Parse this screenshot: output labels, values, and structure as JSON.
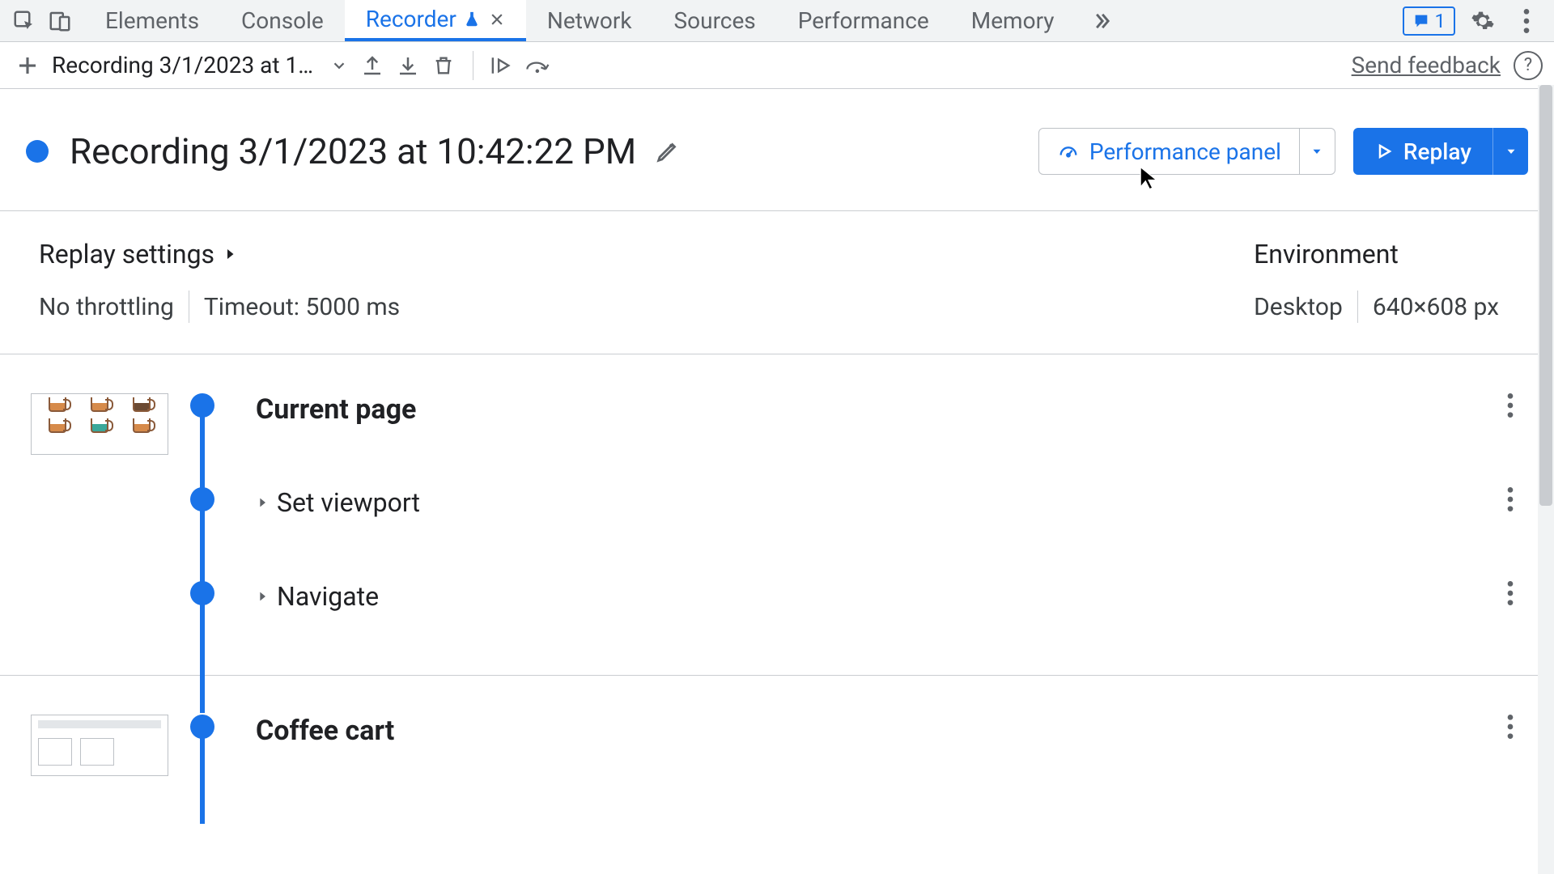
{
  "tabs": {
    "elements": "Elements",
    "console": "Console",
    "recorder": "Recorder",
    "network": "Network",
    "sources": "Sources",
    "performance": "Performance",
    "memory": "Memory"
  },
  "issues_count": "1",
  "toolbar": {
    "recording_select": "Recording 3/1/2023 at 10…",
    "feedback": "Send feedback"
  },
  "title": "Recording 3/1/2023 at 10:42:22 PM",
  "perf_panel": "Performance panel",
  "replay": "Replay",
  "settings": {
    "header": "Replay settings",
    "throttling": "No throttling",
    "timeout": "Timeout: 5000 ms"
  },
  "environment": {
    "header": "Environment",
    "device": "Desktop",
    "viewport": "640×608 px"
  },
  "steps": {
    "current_page": "Current page",
    "set_viewport": "Set viewport",
    "navigate": "Navigate",
    "coffee_cart": "Coffee cart"
  }
}
